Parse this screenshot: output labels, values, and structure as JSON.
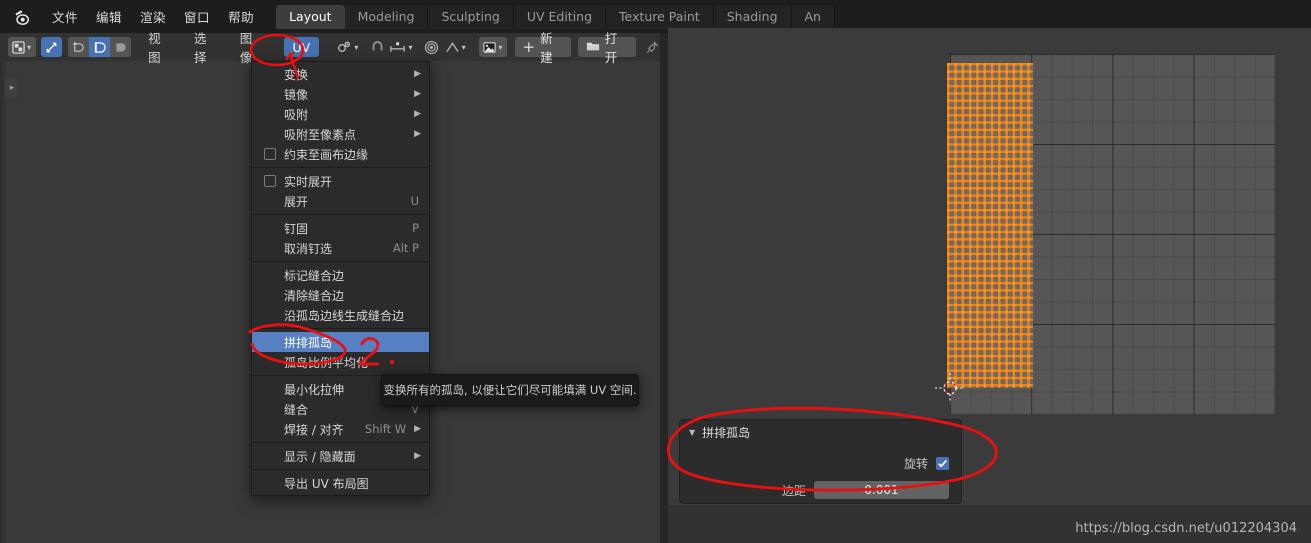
{
  "app": {
    "logo_icon": "blender-logo-icon",
    "menus": [
      "文件",
      "编辑",
      "渲染",
      "窗口",
      "帮助"
    ],
    "workspace_tabs": [
      {
        "label": "Layout",
        "active": true
      },
      {
        "label": "Modeling",
        "active": false
      },
      {
        "label": "Sculpting",
        "active": false
      },
      {
        "label": "UV Editing",
        "active": false
      },
      {
        "label": "Texture Paint",
        "active": false
      },
      {
        "label": "Shading",
        "active": false
      },
      {
        "label": "An",
        "active": false
      }
    ]
  },
  "editor_header": {
    "editor_type_icon": "uv-editor-icon",
    "editor_type_chevron": "▾",
    "mode_icon": "uv-sync-icon",
    "select_mode_icons": [
      "vertex-select-icon",
      "edge-select-icon",
      "face-select-icon",
      "island-select-icon"
    ],
    "select_mode_active_index": 1,
    "menus": [
      "视图",
      "选择",
      "图像"
    ],
    "uv_menu_label": "UV",
    "pivot_icon": "pivot-point-icon",
    "snap_magnet_icon": "magnet-icon",
    "snap_target_icon": "snap-target-icon",
    "proportional_icon": "proportional-edit-icon",
    "falloff_icon": "falloff-curve-icon",
    "image_browse_icon": "image-datablock-icon",
    "new_button": {
      "icon": "plus-icon",
      "label": "新建"
    },
    "open_button": {
      "icon": "folder-icon",
      "label": "打开"
    },
    "pin_icon": "pin-icon"
  },
  "uv_menu": {
    "items": [
      {
        "label": "变换",
        "shortcut": "",
        "submenu": true,
        "checkbox": false,
        "checked": false,
        "selected": false
      },
      {
        "label": "镜像",
        "shortcut": "",
        "submenu": true,
        "checkbox": false,
        "checked": false,
        "selected": false
      },
      {
        "label": "吸附",
        "shortcut": "",
        "submenu": true,
        "checkbox": false,
        "checked": false,
        "selected": false
      },
      {
        "label": "吸附至像素点",
        "shortcut": "",
        "submenu": true,
        "checkbox": false,
        "checked": false,
        "selected": false
      },
      {
        "label": "约束至画布边缘",
        "shortcut": "",
        "submenu": false,
        "checkbox": true,
        "checked": false,
        "selected": false
      },
      {
        "divider": true
      },
      {
        "label": "实时展开",
        "shortcut": "",
        "submenu": false,
        "checkbox": true,
        "checked": false,
        "selected": false
      },
      {
        "label": "展开",
        "shortcut": "U",
        "submenu": false,
        "checkbox": false,
        "checked": false,
        "selected": false
      },
      {
        "divider": true
      },
      {
        "label": "钉固",
        "shortcut": "P",
        "submenu": false,
        "checkbox": false,
        "checked": false,
        "selected": false
      },
      {
        "label": "取消钉选",
        "shortcut": "Alt P",
        "submenu": false,
        "checkbox": false,
        "checked": false,
        "selected": false
      },
      {
        "divider": true
      },
      {
        "label": "标记缝合边",
        "shortcut": "",
        "submenu": false,
        "checkbox": false,
        "checked": false,
        "selected": false
      },
      {
        "label": "清除缝合边",
        "shortcut": "",
        "submenu": false,
        "checkbox": false,
        "checked": false,
        "selected": false
      },
      {
        "label": "沿孤岛边线生成缝合边",
        "shortcut": "",
        "submenu": false,
        "checkbox": false,
        "checked": false,
        "selected": false
      },
      {
        "divider": true
      },
      {
        "label": "拼排孤岛",
        "shortcut": "",
        "submenu": false,
        "checkbox": false,
        "checked": false,
        "selected": true
      },
      {
        "label": "孤岛比例平均化",
        "shortcut": "",
        "submenu": false,
        "checkbox": false,
        "checked": false,
        "selected": false
      },
      {
        "divider": true
      },
      {
        "label": "最小化拉伸",
        "shortcut": "",
        "submenu": false,
        "checkbox": false,
        "checked": false,
        "selected": false
      },
      {
        "label": "缝合",
        "shortcut": "V",
        "submenu": false,
        "checkbox": false,
        "checked": false,
        "selected": false
      },
      {
        "label": "焊接 / 对齐",
        "shortcut": "Shift W",
        "submenu": true,
        "checkbox": false,
        "checked": false,
        "selected": false
      },
      {
        "divider": true
      },
      {
        "label": "显示 / 隐藏面",
        "shortcut": "",
        "submenu": true,
        "checkbox": false,
        "checked": false,
        "selected": false
      },
      {
        "divider": true
      },
      {
        "label": "导出 UV 布局图",
        "shortcut": "",
        "submenu": false,
        "checkbox": false,
        "checked": false,
        "selected": false
      }
    ]
  },
  "tooltip": {
    "text": "变换所有的孤岛, 以便让它们尽可能填满 UV 空间."
  },
  "redo_panel": {
    "title": "拼排孤岛",
    "collapse_icon": "▼",
    "rotate_label": "旋转",
    "rotate_checked": true,
    "margin_label": "边距",
    "margin_value": "0.001"
  },
  "uv_canvas": {
    "island_color": "#ed8213",
    "grid_color": "#565656",
    "cursor_icon": "2d-cursor-icon"
  },
  "annotations": {
    "marks": [
      "1",
      "2"
    ],
    "color": "#e81010"
  },
  "footer": {
    "watermark": "https://blog.csdn.net/u012204304"
  }
}
